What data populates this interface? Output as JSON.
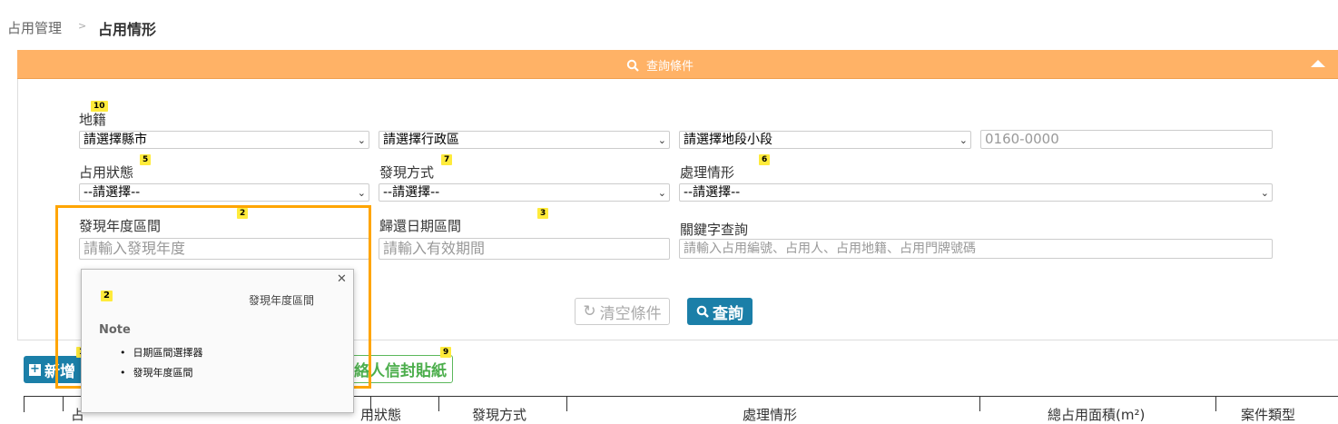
{
  "breadcrumb": {
    "root": "占用管理",
    "separator": ">",
    "current": "占用情形"
  },
  "query_panel": {
    "title": "查詢條件",
    "accent": "#ffb266"
  },
  "fields": {
    "land": {
      "label": "地籍",
      "badge": "10",
      "county": "請選擇縣市",
      "district": "請選擇行政區",
      "section": "請選擇地段小段",
      "lot": "0160-0000"
    },
    "occupancy_status": {
      "label": "占用狀態",
      "badge": "5",
      "value": "--請選擇--"
    },
    "discovery_method": {
      "label": "發現方式",
      "badge": "7",
      "value": "--請選擇--"
    },
    "handling_status": {
      "label": "處理情形",
      "badge": "6",
      "value": "--請選擇--"
    },
    "discovery_year": {
      "label": "發現年度區間",
      "badge": "2",
      "placeholder": "請輸入發現年度"
    },
    "return_date": {
      "label": "歸還日期區間",
      "badge": "3",
      "placeholder": "請輸入有效期間"
    },
    "keyword": {
      "label": "關鍵字查詢",
      "placeholder": "請輸入占用編號、占用人、占用地籍、占用門牌號碼"
    }
  },
  "buttons": {
    "clear": "清空條件",
    "search": "查詢",
    "add": "新增",
    "envelope": "絡人信封貼紙",
    "envelope_badge": "9",
    "add_badge": "1"
  },
  "popover": {
    "badge": "2",
    "title": "發現年度區間",
    "note_label": "Note",
    "items": [
      "日期區間選擇器",
      "發現年度區間"
    ]
  },
  "table_headers_partial": [
    "占",
    "用狀態",
    "發現方式",
    "處理情形",
    "總占用面積(m²)",
    "案件類型"
  ],
  "colors": {
    "primary": "#1b7fa8",
    "success": "#4cae4c",
    "highlight": "#ffa500",
    "badge": "#ffeb3b"
  }
}
